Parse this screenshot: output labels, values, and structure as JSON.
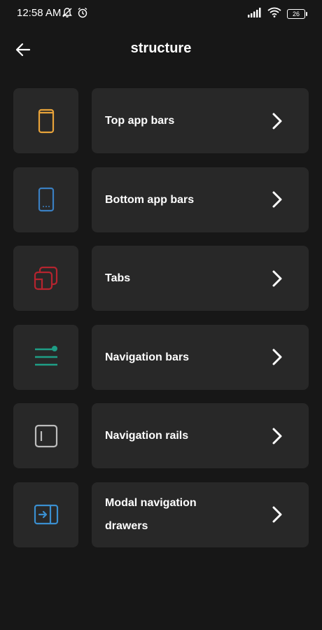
{
  "status_bar": {
    "time": "12:58 AM",
    "battery": "26"
  },
  "app_bar": {
    "title": "structure",
    "back_icon": "arrow-left-icon"
  },
  "items": [
    {
      "label": "Top app bars",
      "icon": "top-app-bar-icon",
      "color": "#E8A33A"
    },
    {
      "label": "Bottom app bars",
      "icon": "bottom-app-bar-icon",
      "color": "#3A7FC1"
    },
    {
      "label": "Tabs",
      "icon": "tabs-icon",
      "color": "#B5242F"
    },
    {
      "label": "Navigation bars",
      "icon": "navigation-bars-icon",
      "color": "#1E9E86"
    },
    {
      "label": "Navigation rails",
      "icon": "navigation-rail-icon",
      "color": "#BDBDBD"
    },
    {
      "label": "Modal navigation drawers",
      "icon": "modal-drawer-icon",
      "color": "#3A8FD0"
    }
  ],
  "colors": {
    "background": "#171717",
    "card": "#282828",
    "text": "#FFFFFF"
  }
}
